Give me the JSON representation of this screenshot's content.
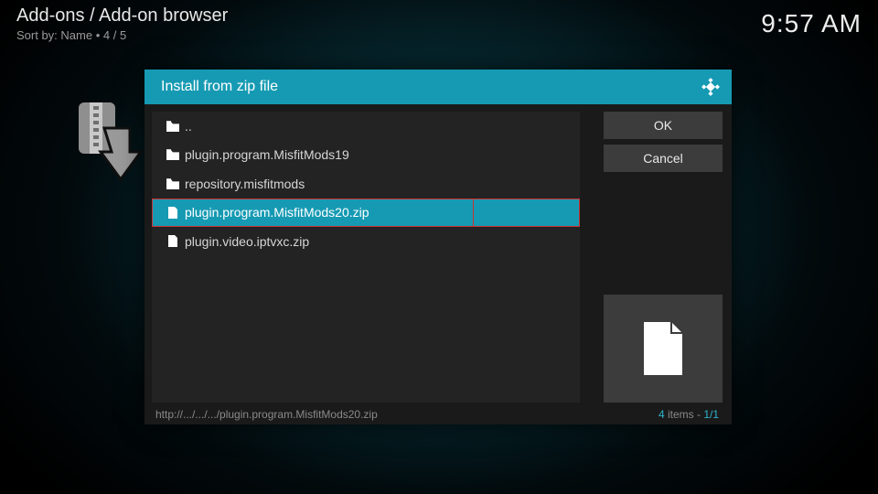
{
  "header": {
    "breadcrumb": "Add-ons / Add-on browser",
    "sort_prefix": "Sort by: ",
    "sort_field": "Name",
    "sort_sep": "  •  ",
    "position": "4 / 5",
    "clock": "9:57 AM"
  },
  "dialog": {
    "title": "Install from zip file",
    "buttons": {
      "ok": "OK",
      "cancel": "Cancel"
    },
    "files": [
      {
        "kind": "up",
        "label": ".."
      },
      {
        "kind": "folder",
        "label": "plugin.program.MisfitMods19"
      },
      {
        "kind": "folder",
        "label": "repository.misfitmods"
      },
      {
        "kind": "file",
        "label": "plugin.program.MisfitMods20.zip",
        "selected": true,
        "highlighted": true
      },
      {
        "kind": "file",
        "label": "plugin.video.iptvxc.zip"
      }
    ],
    "path": "http://.../.../.../plugin.program.MisfitMods20.zip",
    "count_num": "4",
    "count_items_word": " items - ",
    "count_page": "1/1"
  },
  "colors": {
    "accent": "#169ab3",
    "highlight_border": "#c33"
  }
}
